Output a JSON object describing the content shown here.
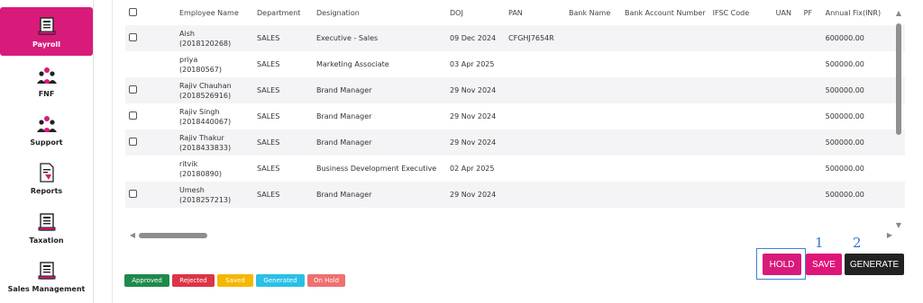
{
  "sidebar": {
    "items": [
      {
        "label": "Payroll",
        "icon": "payroll-icon",
        "active": true
      },
      {
        "label": "FNF",
        "icon": "people-icon"
      },
      {
        "label": "Support",
        "icon": "people-icon"
      },
      {
        "label": "Reports",
        "icon": "report-icon"
      },
      {
        "label": "Taxation",
        "icon": "ledger-icon"
      },
      {
        "label": "Sales Management",
        "icon": "ledger-icon"
      }
    ]
  },
  "table": {
    "headers": [
      "",
      "Employee Name",
      "Department",
      "Designation",
      "DOJ",
      "PAN",
      "Bank Name",
      "Bank Account Number",
      "IFSC Code",
      "UAN",
      "PF",
      "Annual Fix(INR)"
    ],
    "rows": [
      {
        "checkbox": true,
        "name": "Aish",
        "id": "(2018120268)",
        "department": "SALES",
        "designation": "Executive - Sales",
        "doj": "09 Dec 2024",
        "pan": "CFGHJ7654R",
        "bank_name": "",
        "account": "",
        "ifsc": "",
        "uan": "",
        "pf": "",
        "annual_fix": "600000.00"
      },
      {
        "checkbox": false,
        "name": "priya",
        "id": "(20180567)",
        "department": "SALES",
        "designation": "Marketing Associate",
        "doj": "03 Apr 2025",
        "pan": "",
        "bank_name": "",
        "account": "",
        "ifsc": "",
        "uan": "",
        "pf": "",
        "annual_fix": "500000.00"
      },
      {
        "checkbox": true,
        "name": "Rajiv Chauhan",
        "id": "(2018526916)",
        "department": "SALES",
        "designation": "Brand Manager",
        "doj": "29 Nov 2024",
        "pan": "",
        "bank_name": "",
        "account": "",
        "ifsc": "",
        "uan": "",
        "pf": "",
        "annual_fix": "500000.00"
      },
      {
        "checkbox": true,
        "name": "Rajiv Singh",
        "id": "(2018440067)",
        "department": "SALES",
        "designation": "Brand Manager",
        "doj": "29 Nov 2024",
        "pan": "",
        "bank_name": "",
        "account": "",
        "ifsc": "",
        "uan": "",
        "pf": "",
        "annual_fix": "500000.00"
      },
      {
        "checkbox": true,
        "name": "Rajiv Thakur",
        "id": "(2018433833)",
        "department": "SALES",
        "designation": "Brand Manager",
        "doj": "29 Nov 2024",
        "pan": "",
        "bank_name": "",
        "account": "",
        "ifsc": "",
        "uan": "",
        "pf": "",
        "annual_fix": "500000.00"
      },
      {
        "checkbox": false,
        "name": "ritvik",
        "id": "(20180890)",
        "department": "SALES",
        "designation": "Business Development Executive",
        "doj": "02 Apr 2025",
        "pan": "",
        "bank_name": "",
        "account": "",
        "ifsc": "",
        "uan": "",
        "pf": "",
        "annual_fix": "500000.00"
      },
      {
        "checkbox": true,
        "name": "Umesh",
        "id": "(2018257213)",
        "department": "SALES",
        "designation": "Brand Manager",
        "doj": "29 Nov 2024",
        "pan": "",
        "bank_name": "",
        "account": "",
        "ifsc": "",
        "uan": "",
        "pf": "",
        "annual_fix": "500000.00"
      }
    ]
  },
  "annotations": {
    "one": "1",
    "two": "2"
  },
  "actions": {
    "hold": {
      "label": "HOLD",
      "color": "#d81b7a"
    },
    "save": {
      "label": "SAVE",
      "color": "#e0157a"
    },
    "generate": {
      "label": "GENERATE",
      "color": "#222222"
    }
  },
  "legend": [
    {
      "label": "Approved",
      "color": "#1e8a4c"
    },
    {
      "label": "Rejected",
      "color": "#dc3545"
    },
    {
      "label": "Saved",
      "color": "#f5b800"
    },
    {
      "label": "Generated",
      "color": "#29c0e6"
    },
    {
      "label": "On Hold",
      "color": "#f07070"
    }
  ]
}
